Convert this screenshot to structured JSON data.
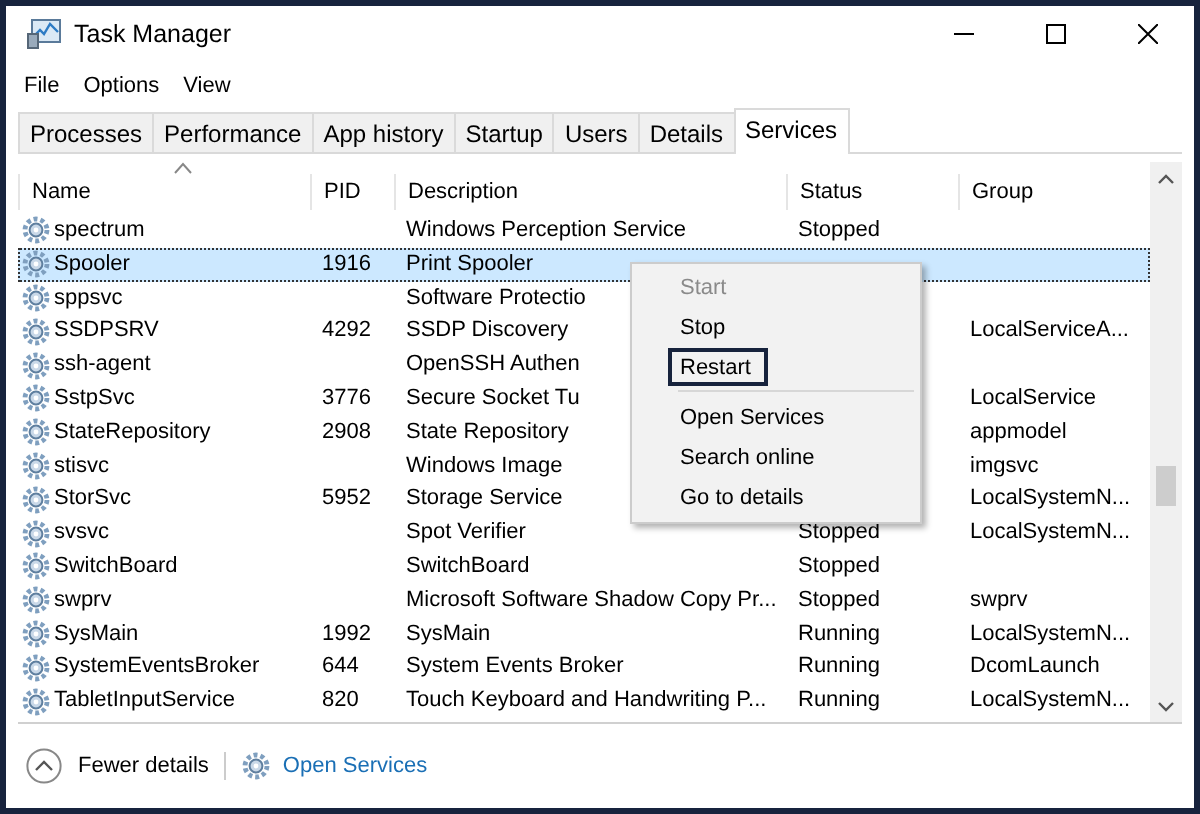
{
  "window": {
    "title": "Task Manager"
  },
  "menu_bar": [
    "File",
    "Options",
    "View"
  ],
  "tabs": [
    {
      "label": "Processes",
      "selected": false
    },
    {
      "label": "Performance",
      "selected": false
    },
    {
      "label": "App history",
      "selected": false
    },
    {
      "label": "Startup",
      "selected": false
    },
    {
      "label": "Users",
      "selected": false
    },
    {
      "label": "Details",
      "selected": false
    },
    {
      "label": "Services",
      "selected": true
    }
  ],
  "table": {
    "columns": [
      "Name",
      "PID",
      "Description",
      "Status",
      "Group"
    ],
    "rows": [
      {
        "name": "spectrum",
        "pid": "",
        "description": "Windows Perception Service",
        "status": "Stopped",
        "group": "",
        "selected": false
      },
      {
        "name": "Spooler",
        "pid": "1916",
        "description": "Print Spooler",
        "status": "",
        "group": "",
        "selected": true
      },
      {
        "name": "sppsvc",
        "pid": "",
        "description": "Software Protectio",
        "status": "",
        "group": "",
        "selected": false
      },
      {
        "name": "SSDPSRV",
        "pid": "4292",
        "description": "SSDP Discovery",
        "status": "",
        "group": "LocalServiceA...",
        "selected": false
      },
      {
        "name": "ssh-agent",
        "pid": "",
        "description": "OpenSSH Authen",
        "status": "",
        "group": "",
        "selected": false
      },
      {
        "name": "SstpSvc",
        "pid": "3776",
        "description": "Secure Socket Tu",
        "status": "",
        "group": "LocalService",
        "selected": false
      },
      {
        "name": "StateRepository",
        "pid": "2908",
        "description": "State Repository",
        "status": "",
        "group": "appmodel",
        "selected": false
      },
      {
        "name": "stisvc",
        "pid": "",
        "description": "Windows Image",
        "status": "",
        "group": "imgsvc",
        "selected": false
      },
      {
        "name": "StorSvc",
        "pid": "5952",
        "description": "Storage Service",
        "status": "",
        "group": "LocalSystemN...",
        "selected": false
      },
      {
        "name": "svsvc",
        "pid": "",
        "description": "Spot Verifier",
        "status": "Stopped",
        "group": "LocalSystemN...",
        "selected": false
      },
      {
        "name": "SwitchBoard",
        "pid": "",
        "description": "SwitchBoard",
        "status": "Stopped",
        "group": "",
        "selected": false
      },
      {
        "name": "swprv",
        "pid": "",
        "description": "Microsoft Software Shadow Copy Pr...",
        "status": "Stopped",
        "group": "swprv",
        "selected": false
      },
      {
        "name": "SysMain",
        "pid": "1992",
        "description": "SysMain",
        "status": "Running",
        "group": "LocalSystemN...",
        "selected": false
      },
      {
        "name": "SystemEventsBroker",
        "pid": "644",
        "description": "System Events Broker",
        "status": "Running",
        "group": "DcomLaunch",
        "selected": false
      },
      {
        "name": "TabletInputService",
        "pid": "820",
        "description": "Touch Keyboard and Handwriting P...",
        "status": "Running",
        "group": "LocalSystemN...",
        "selected": false
      }
    ]
  },
  "context_menu": [
    {
      "kind": "item",
      "label": "Start",
      "disabled": true,
      "focused": false
    },
    {
      "kind": "item",
      "label": "Stop",
      "disabled": false,
      "focused": false
    },
    {
      "kind": "item",
      "label": "Restart",
      "disabled": false,
      "focused": true
    },
    {
      "kind": "separator"
    },
    {
      "kind": "item",
      "label": "Open Services",
      "disabled": false,
      "focused": false
    },
    {
      "kind": "item",
      "label": "Search online",
      "disabled": false,
      "focused": false
    },
    {
      "kind": "item",
      "label": "Go to details",
      "disabled": false,
      "focused": false
    }
  ],
  "footer": {
    "toggle": "Fewer details",
    "link": "Open Services"
  }
}
